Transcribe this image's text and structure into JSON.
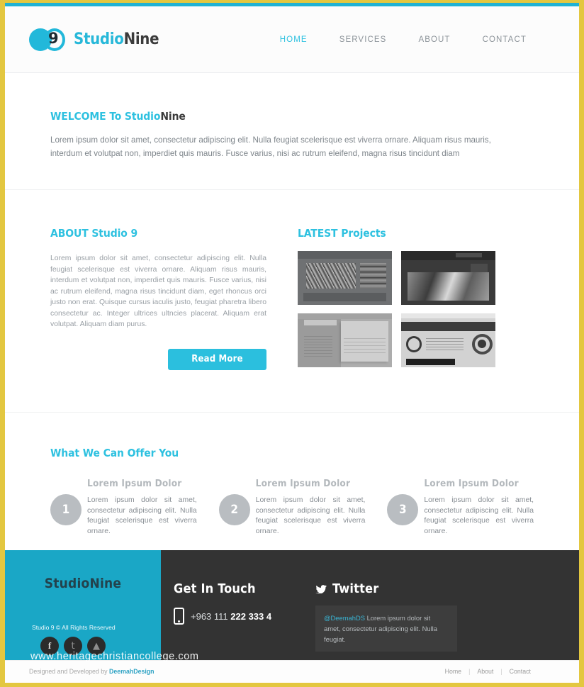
{
  "theme": {
    "accent": "#2ec1e0",
    "accent_dark": "#1aa7c6",
    "frame_border": "#e3c740",
    "footer_bg": "#333333",
    "muted_text": "#8d949a"
  },
  "header": {
    "logo": {
      "icon": "studionine-logo-icon",
      "nine_glyph": "9",
      "brand_first": "Studio",
      "brand_second": "Nine"
    },
    "nav": [
      {
        "label": "HOME",
        "active": true
      },
      {
        "label": "SERVICES",
        "active": false
      },
      {
        "label": "ABOUT",
        "active": false
      },
      {
        "label": "CONTACT",
        "active": false
      }
    ]
  },
  "welcome": {
    "title_accent": "WELCOME To Studio",
    "title_dark": "Nine",
    "paragraph": "Lorem ipsum dolor sit amet, consectetur adipiscing elit. Nulla feugiat scelerisque est viverra ornare. Aliquam risus mauris, interdum et volutpat non, imperdiet quis mauris. Fusce varius, nisi ac rutrum eleifend, magna risus tincidunt diam"
  },
  "about": {
    "title_accent": "ABOUT ",
    "title_rest": "Studio 9",
    "paragraph": "Lorem ipsum dolor sit amet, consectetur adipiscing elit. Nulla feugiat scelerisque est viverra ornare. Aliquam risus mauris, interdum et volutpat non, imperdiet quis mauris. Fusce varius, nisi ac rutrum eleifend, magna risus tincidunt diam, eget rhoncus orci justo non erat. Quisque cursus iaculis justo, feugiat pharetra libero consectetur ac. Integer ultrices ultncies placerat. Aliquam erat volutpat. Aliquam diam purus.",
    "read_more": "Read More"
  },
  "projects": {
    "title_accent": "LATEST ",
    "title_rest": "Projects",
    "thumbs": [
      {
        "name": "project-thumbnail-1"
      },
      {
        "name": "project-thumbnail-2"
      },
      {
        "name": "project-thumbnail-3"
      },
      {
        "name": "project-thumbnail-4"
      }
    ]
  },
  "offers": {
    "title": "What We Can Offer You",
    "items": [
      {
        "number": "1",
        "title": "Lorem Ipsum Dolor",
        "text": "Lorem ipsum dolor sit amet, consectetur adipiscing elit. Nulla feugiat scelerisque est viverra ornare."
      },
      {
        "number": "2",
        "title": "Lorem Ipsum Dolor",
        "text": "Lorem ipsum dolor sit amet, consectetur adipiscing elit. Nulla feugiat scelerisque est viverra ornare."
      },
      {
        "number": "3",
        "title": "Lorem Ipsum Dolor",
        "text": "Lorem ipsum dolor sit amet, consectetur adipiscing elit. Nulla feugiat scelerisque est viverra ornare."
      }
    ]
  },
  "footer": {
    "brand": {
      "name_first": "Studio",
      "name_second": "Nine",
      "full": "StudioNine"
    },
    "rights": "Studio 9 © All Rights Reserved",
    "social": [
      {
        "icon": "facebook-icon",
        "glyph": "f"
      },
      {
        "icon": "twitter-icon",
        "glyph": "t"
      },
      {
        "icon": "rss-icon",
        "glyph": "▲"
      }
    ],
    "touch": {
      "heading": "Get In Touch",
      "phone_icon": "mobile-phone-icon",
      "phone_plain": "+963 111 ",
      "phone_bold": "222 333 4"
    },
    "twitter": {
      "icon": "twitter-bird-icon",
      "heading": "Twitter",
      "handle": "@DeemahDS",
      "tweet": " Lorem ipsum dolor sit amet, consectetur adipiscing elit. Nulla feugiat."
    }
  },
  "bottom": {
    "credit_text": "Designed and Developed by ",
    "credit_author": "DeemahDesign",
    "links": [
      {
        "label": "Home"
      },
      {
        "label": "About"
      },
      {
        "label": "Contact"
      }
    ],
    "separator": "|"
  },
  "watermark": {
    "text": "www.heritagechristiancollege.com"
  }
}
